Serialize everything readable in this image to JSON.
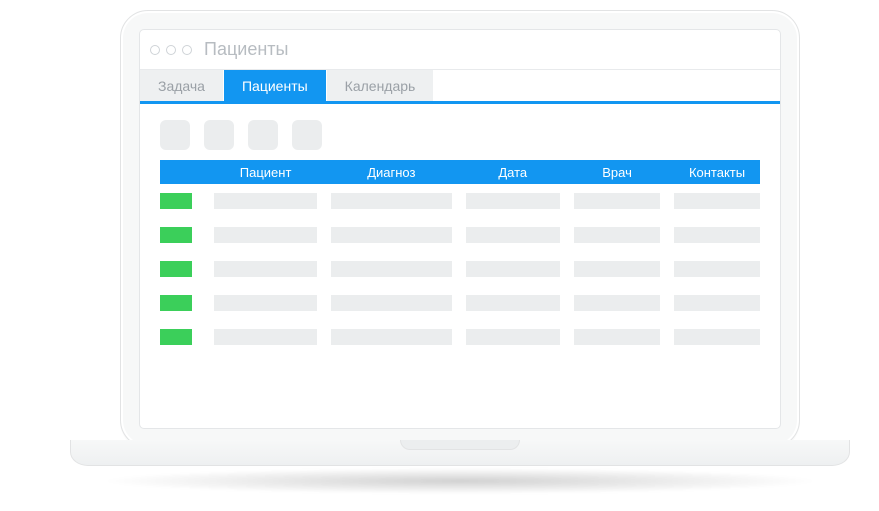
{
  "window": {
    "title": "Пациенты"
  },
  "tabs": [
    {
      "label": "Задача",
      "active": false
    },
    {
      "label": "Пациенты",
      "active": true
    },
    {
      "label": "Календарь",
      "active": false
    }
  ],
  "toolbar": {
    "button_count": 4
  },
  "table": {
    "columns": [
      {
        "label": ""
      },
      {
        "label": "Пациент"
      },
      {
        "label": "Диагноз"
      },
      {
        "label": "Дата"
      },
      {
        "label": "Врач"
      },
      {
        "label": "Контакты"
      }
    ],
    "row_count": 5,
    "status_color": "#3bcf5a"
  },
  "colors": {
    "accent": "#1296f1",
    "skeleton": "#ebedee"
  }
}
